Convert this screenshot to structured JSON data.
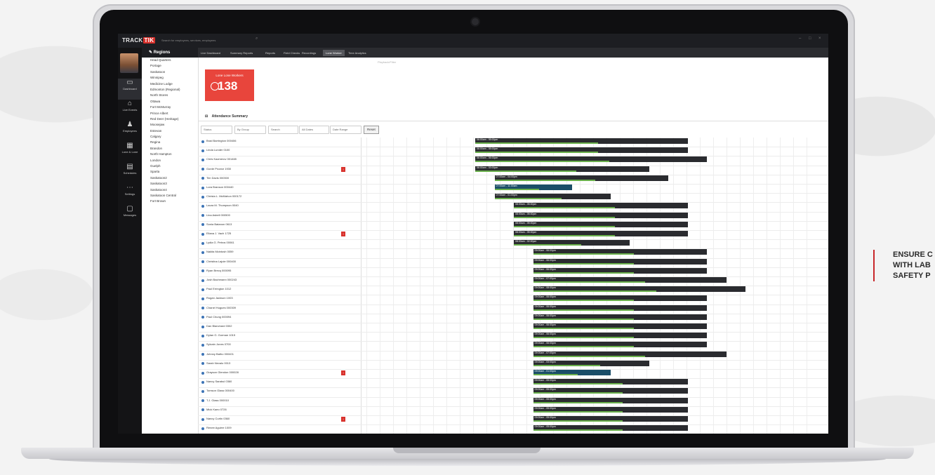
{
  "app": {
    "brand_left": "TRACK",
    "brand_right": "TIK",
    "search_placeholder": "Search for employees, services, employees"
  },
  "sidebar": {
    "items": [
      {
        "label": "Dashboard",
        "icon": "monitor-icon"
      },
      {
        "label": "Live Events",
        "icon": "broadcast-icon"
      },
      {
        "label": "Employees",
        "icon": "people-icon"
      },
      {
        "label": "Lone & Lone",
        "icon": "map-icon"
      },
      {
        "label": "Schedules",
        "icon": "calendar-icon"
      },
      {
        "label": "Settings",
        "icon": "dots-icon"
      },
      {
        "label": "Messages",
        "icon": "chat-icon"
      }
    ]
  },
  "regions": {
    "title": "Regions",
    "items": [
      "Head Quarters",
      "Portage",
      "Saskatoon",
      "Winnipeg",
      "Medicine Lodge",
      "Edmonton (Regional)",
      "North Stores",
      "Ottawa",
      "Fort McMurray",
      "Prince Albert",
      "Red Deer (Heritage)",
      "Moosejaw",
      "Estevan",
      "Calgary",
      "Regina",
      "Brandon",
      "North Hampton",
      "London",
      "Guelph",
      "Sparta",
      "Saskatoon2",
      "Saskatoon3",
      "Saskatoon4",
      "Saskatoon Central",
      "Fort Brown"
    ]
  },
  "tabs": {
    "items": [
      "Live Dashboard",
      "Summary Reports",
      "Reports",
      "Field Checks",
      "Recordings",
      "Lone Worker",
      "Time Analytics"
    ],
    "active_index": 5,
    "sub_label": "Playback/Filter"
  },
  "kpi": {
    "label": "Lone Lone Workers",
    "value": "138"
  },
  "section": {
    "title": "Attendance Summary"
  },
  "filters": {
    "fields": [
      "Status",
      "By Group",
      "Search",
      "All Dates",
      "Date Range"
    ],
    "reset_label": "Reset"
  },
  "employees": [
    {
      "name": "Brad Barrington 000406",
      "alert": false,
      "shift": "06:00am - 05:00pm"
    },
    {
      "name": "Linda Lunder 0100",
      "alert": false,
      "shift": "06:00am - 05:00pm"
    },
    {
      "name": "Chris Kazmerov 001465",
      "alert": false,
      "shift": "06:00am - 06:00pm"
    },
    {
      "name": "Gorde Proctor 1930",
      "alert": true,
      "shift": "06:00am - 03:00pm"
    },
    {
      "name": "Tim Davis 000300",
      "alert": false,
      "shift": "07:00am - 04:00pm"
    },
    {
      "name": "Lora Branson 000440",
      "alert": false,
      "shift": "07:00am - 11:00am"
    },
    {
      "name": "Christa L. McMahon 000172",
      "alert": false,
      "shift": "07:00am - 01:00pm"
    },
    {
      "name": "Laura M. Thompson 0040",
      "alert": false,
      "shift": "08:00am - 05:00pm"
    },
    {
      "name": "Lina Asbell 000500",
      "alert": false,
      "shift": "08:00am - 05:00pm"
    },
    {
      "name": "Sonia Batanon 0613",
      "alert": false,
      "shift": "08:00am - 05:00pm"
    },
    {
      "name": "Eliana J. Vach 1725",
      "alert": true,
      "shift": "08:00am - 05:00pm"
    },
    {
      "name": "Lydia G. Petros 00061",
      "alert": false,
      "shift": "08:00am - 02:00pm"
    },
    {
      "name": "Nakita Mcintosh 0059",
      "alert": false,
      "shift": "09:00am - 06:00pm"
    },
    {
      "name": "Christina Lajoie 000400",
      "alert": false,
      "shift": "09:00am - 06:00pm"
    },
    {
      "name": "Ryan Brecq 000095",
      "alert": false,
      "shift": "09:00am - 06:00pm"
    },
    {
      "name": "Josh Bachmann 000243",
      "alert": false,
      "shift": "09:00am - 07:00pm"
    },
    {
      "name": "Paul Errington 1012",
      "alert": false,
      "shift": "09:00am - 08:00pm"
    },
    {
      "name": "Rogan Jackson 1003",
      "alert": false,
      "shift": "09:00am - 06:00pm"
    },
    {
      "name": "Chanel Hugues 000309",
      "alert": false,
      "shift": "09:00am - 06:00pm"
    },
    {
      "name": "Paul Chung 000094",
      "alert": false,
      "shift": "09:00am - 06:00pm"
    },
    {
      "name": "Dan Blanchard 0302",
      "alert": false,
      "shift": "09:00am - 06:00pm"
    },
    {
      "name": "Dylan G. Gorman 1015",
      "alert": false,
      "shift": "09:00am - 06:00pm"
    },
    {
      "name": "Sylvain Jones 0700",
      "alert": false,
      "shift": "09:00am - 06:00pm"
    },
    {
      "name": "Johnny Batho 000401",
      "alert": false,
      "shift": "09:00am - 07:00pm"
    },
    {
      "name": "Sarah Nevalo 0013",
      "alert": false,
      "shift": "09:00am - 03:00pm"
    },
    {
      "name": "Grayson Glendon 000028",
      "alert": true,
      "shift": "09:00am - 01:00pm"
    },
    {
      "name": "Nancy Sarabul 0360",
      "alert": false,
      "shift": "09:00am - 05:00pm"
    },
    {
      "name": "Tomson Glass 000400",
      "alert": false,
      "shift": "09:00am - 05:00pm"
    },
    {
      "name": "T.J. Glass 000010",
      "alert": false,
      "shift": "09:00am - 05:00pm"
    },
    {
      "name": "Mick Kaeo 0726",
      "alert": false,
      "shift": "09:00am - 05:00pm"
    },
    {
      "name": "Nancy Curtin 0360",
      "alert": true,
      "shift": "09:00am - 05:00pm"
    },
    {
      "name": "Renee Aguirre 1009",
      "alert": false,
      "shift": "09:00am - 05:00pm"
    }
  ],
  "caption": {
    "line1": "ENSURE C",
    "line2": "WITH LAB",
    "line3": "SAFETY P"
  },
  "colors": {
    "accent_red": "#d8312c",
    "kpi_red": "#e8453c",
    "bar_dark": "#2a2b2f",
    "bar_green": "#6ab04c",
    "bar_blue": "#1b4e68",
    "nav_dark": "#141416"
  }
}
